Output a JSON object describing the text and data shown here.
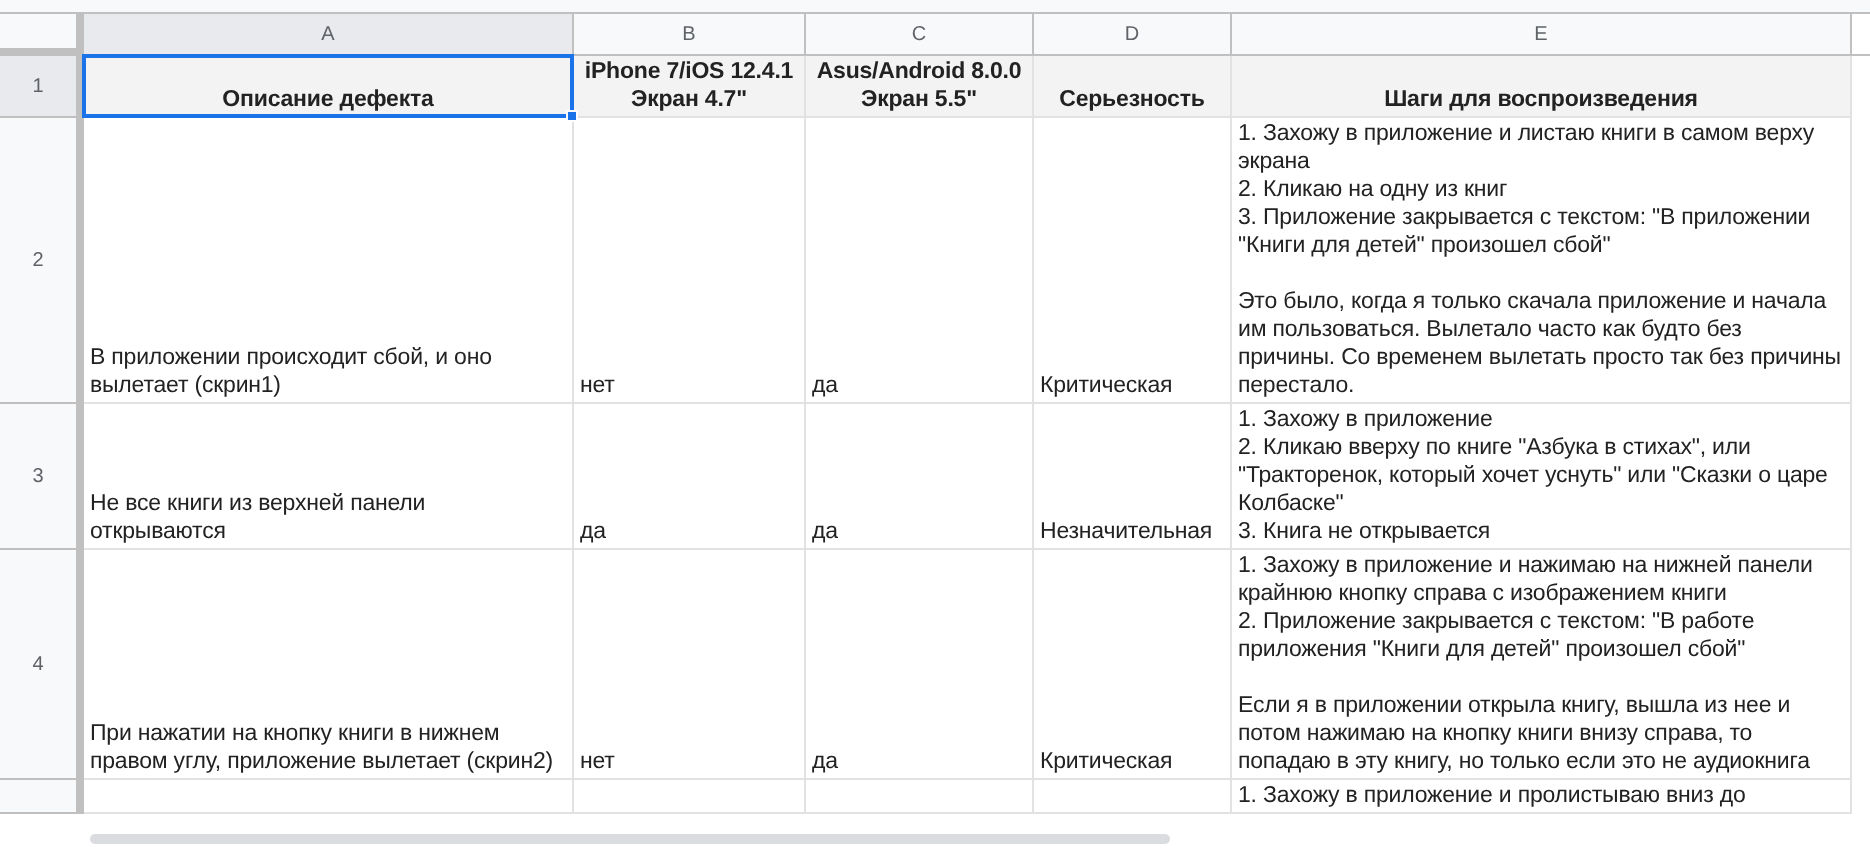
{
  "columns": [
    {
      "label": "A",
      "selected": true
    },
    {
      "label": "B",
      "selected": false
    },
    {
      "label": "C",
      "selected": false
    },
    {
      "label": "D",
      "selected": false
    },
    {
      "label": "E",
      "selected": false
    }
  ],
  "rows": [
    {
      "number": "1",
      "kind": "header",
      "selected": true,
      "cells": [
        "Описание дефекта",
        "iPhone 7/iOS 12.4.1 Экран 4.7\"",
        "Asus/Android 8.0.0 Экран 5.5\"",
        "Серьезность",
        "Шаги для воспроизведения"
      ]
    },
    {
      "number": "2",
      "kind": "body",
      "selected": false,
      "cells": [
        "В приложении происходит сбой, и оно вылетает (скрин1)",
        "нет",
        "да",
        "Критическая",
        "1. Захожу в приложение и листаю книги в самом верху экрана\n2. Кликаю на одну из книг\n3. Приложение закрывается с текстом: \"В приложении \"Книги для детей\" произошел сбой\"\n\nЭто было, когда я только скачала приложение и начала им пользоваться. Вылетало часто как будто без причины. Со временем вылетать просто так без причины перестало."
      ]
    },
    {
      "number": "3",
      "kind": "body",
      "selected": false,
      "cells": [
        "Не все книги из верхней панели открываются",
        "да",
        "да",
        "Незначительная",
        "1. Захожу в приложение\n2. Кликаю вверху по книге \"Азбука в стихах\", или \"Тракторенок, который хочет уснуть\" или \"Сказки о царе Колбаске\"\n3. Книга не открывается"
      ]
    },
    {
      "number": "4",
      "kind": "body",
      "selected": false,
      "cells": [
        "При нажатии на кнопку книги в нижнем правом углу, приложение вылетает (скрин2)",
        "нет",
        "да",
        "Критическая",
        "1. Захожу в приложение и нажимаю на нижней панели крайнюю кнопку справа с изображением книги\n2. Приложение закрывается с текстом: \"В работе приложения \"Книги для детей\" произошел сбой\"\n\nЕсли я в приложении открыла книгу, вышла из нее и потом нажимаю на кнопку книги внизу справа, то попадаю в эту книгу, но только если это не аудиокнига"
      ]
    },
    {
      "number": "",
      "kind": "body",
      "selected": false,
      "cells": [
        "",
        "",
        "",
        "",
        "1. Захожу в приложение и пролистываю вниз до"
      ]
    }
  ]
}
